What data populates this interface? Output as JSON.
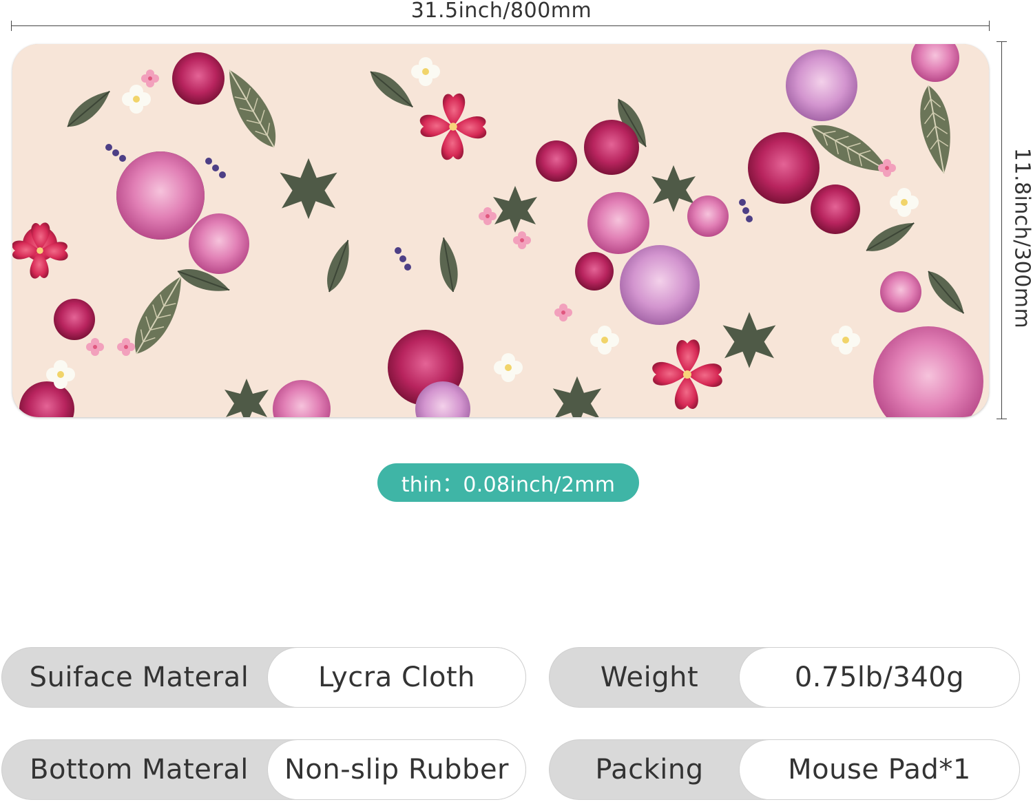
{
  "dimensions": {
    "width_label": "31.5inch/800mm",
    "height_label": "11.8inch/300mm",
    "thickness_label": "thin：0.08inch/2mm"
  },
  "colors": {
    "pad_background": "#f7e5d8",
    "thickness_pill": "#3fb5a6",
    "spec_key_bg": "#d9d9d9",
    "spec_value_bg": "#ffffff"
  },
  "specs": [
    {
      "key": "Suiface Materal",
      "value": "Lycra Cloth"
    },
    {
      "key": "Weight",
      "value": "0.75lb/340g"
    },
    {
      "key": "Bottom Materal",
      "value": "Non-slip Rubber"
    },
    {
      "key": "Packing",
      "value": "Mouse Pad*1"
    }
  ]
}
